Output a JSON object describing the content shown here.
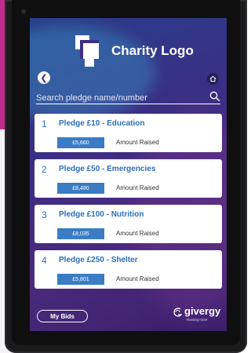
{
  "header": {
    "logo_text": "Charity Logo",
    "back_icon": "chevron-left-icon",
    "home_icon": "home-icon"
  },
  "search": {
    "placeholder": "Search pledge name/number",
    "icon": "search-icon"
  },
  "pledges": [
    {
      "number": "1",
      "title": "Pledge £10 - Education",
      "amount": "£5,660",
      "amount_label": "Amount Raised"
    },
    {
      "number": "2",
      "title": "Pledge £50 - Emergencies",
      "amount": "£8,480",
      "amount_label": "Amount Raised"
    },
    {
      "number": "3",
      "title": "Pledge £100 - Nutrition",
      "amount": "£8,035",
      "amount_label": "Amount Raised"
    },
    {
      "number": "4",
      "title": "Pledge £250 - Shelter",
      "amount": "£5,801",
      "amount_label": "Amount Raised"
    }
  ],
  "footer": {
    "my_bids_label": "My Bids",
    "brand_name": "givergy",
    "brand_tagline": "Raising more"
  },
  "colors": {
    "accent_blue": "#3b7cc4",
    "title_blue": "#2c6fb8",
    "screen_purple": "#3b2e85",
    "side_magenta": "#c02d8b"
  }
}
